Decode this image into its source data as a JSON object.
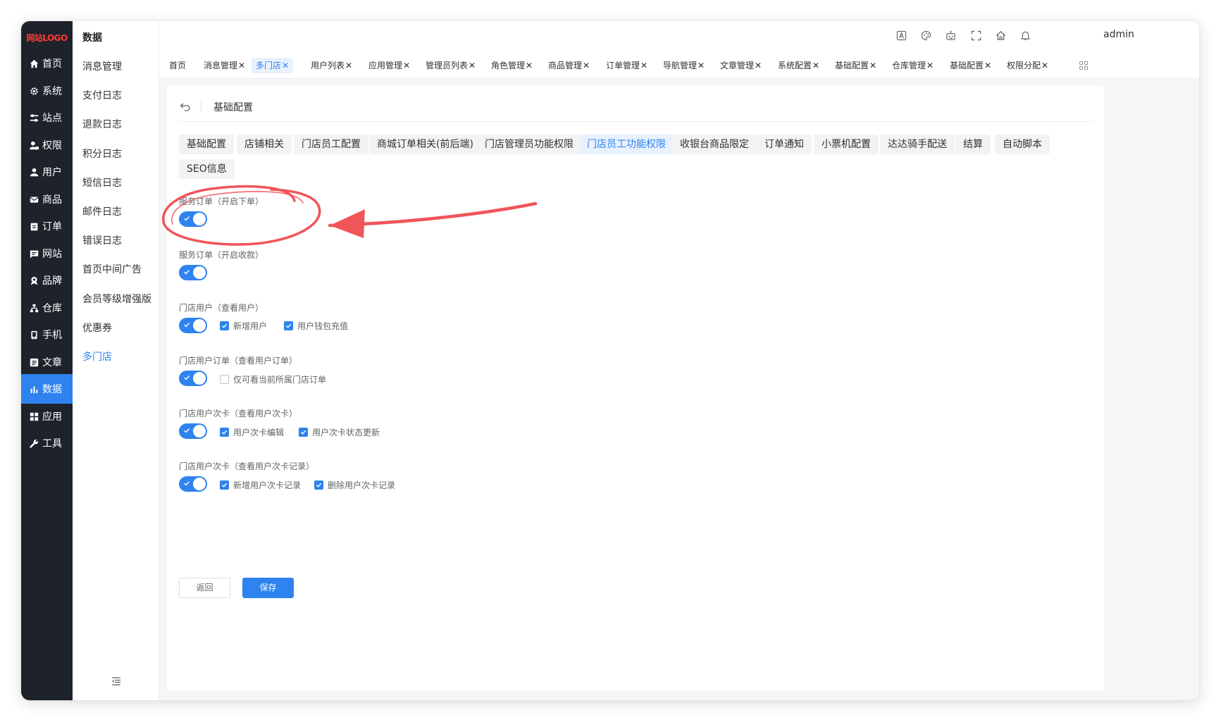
{
  "logo": "网站LOGO",
  "nav": {
    "items": [
      {
        "label": "首页",
        "icon": "home-icon"
      },
      {
        "label": "系统",
        "icon": "gear-icon"
      },
      {
        "label": "站点",
        "icon": "sliders-icon"
      },
      {
        "label": "权限",
        "icon": "user-lock-icon"
      },
      {
        "label": "用户",
        "icon": "user-icon"
      },
      {
        "label": "商品",
        "icon": "envelope-icon"
      },
      {
        "label": "订单",
        "icon": "clipboard-icon"
      },
      {
        "label": "网站",
        "icon": "message-icon"
      },
      {
        "label": "品牌",
        "icon": "award-icon"
      },
      {
        "label": "仓库",
        "icon": "sitemap-icon"
      },
      {
        "label": "手机",
        "icon": "phone-icon"
      },
      {
        "label": "文章",
        "icon": "article-icon"
      },
      {
        "label": "数据",
        "icon": "bar-chart-icon"
      },
      {
        "label": "应用",
        "icon": "grid-icon"
      },
      {
        "label": "工具",
        "icon": "wrench-icon"
      }
    ],
    "active": "数据"
  },
  "sub_menu": {
    "title": "数据",
    "items": [
      "消息管理",
      "支付日志",
      "退款日志",
      "积分日志",
      "短信日志",
      "邮件日志",
      "错误日志",
      "首页中间广告",
      "会员等级增强版",
      "优惠券",
      "多门店"
    ],
    "active": "多门店"
  },
  "header": {
    "icons": [
      "translate-icon",
      "palette-icon",
      "robot-icon",
      "fullscreen-icon",
      "home-icon",
      "bell-icon"
    ],
    "username": "admin"
  },
  "tabs": [
    {
      "label": "首页",
      "closable": false
    },
    {
      "label": "消息管理",
      "closable": true
    },
    {
      "label": "多门店",
      "closable": true
    },
    {
      "label": "用户列表",
      "closable": true
    },
    {
      "label": "应用管理",
      "closable": true
    },
    {
      "label": "管理员列表",
      "closable": true
    },
    {
      "label": "角色管理",
      "closable": true
    },
    {
      "label": "商品管理",
      "closable": true
    },
    {
      "label": "订单管理",
      "closable": true
    },
    {
      "label": "导航管理",
      "closable": true
    },
    {
      "label": "文章管理",
      "closable": true
    },
    {
      "label": "系统配置",
      "closable": true
    },
    {
      "label": "基础配置",
      "closable": true
    },
    {
      "label": "仓库管理",
      "closable": true
    },
    {
      "label": "基础配置",
      "closable": true
    },
    {
      "label": "权限分配",
      "closable": true
    }
  ],
  "active_tab": "多门店",
  "tab_close_glyph": "✕",
  "page": {
    "title": "基础配置",
    "config_tabs": [
      "基础配置",
      "店铺相关",
      "门店员工配置",
      "商城订单相关(前后端)",
      "门店管理员功能权限",
      "门店员工功能权限",
      "收银台商品限定",
      "订单通知",
      "小票机配置",
      "达达骑手配送",
      "结算",
      "自动脚本",
      "SEO信息"
    ],
    "active_config_tab": "门店员工功能权限",
    "permissions": [
      {
        "label": "服务订单（开启下单）",
        "enabled": true,
        "options": []
      },
      {
        "label": "服务订单（开启收款）",
        "enabled": true,
        "options": []
      },
      {
        "label": "门店用户（查看用户）",
        "enabled": true,
        "options": [
          {
            "label": "新增用户",
            "checked": true
          },
          {
            "label": "用户钱包充值",
            "checked": true
          }
        ]
      },
      {
        "label": "门店用户订单（查看用户订单）",
        "enabled": true,
        "options": [
          {
            "label": "仅可看当前所属门店订单",
            "checked": false
          }
        ]
      },
      {
        "label": "门店用户次卡（查看用户次卡）",
        "enabled": true,
        "options": [
          {
            "label": "用户次卡编辑",
            "checked": true
          },
          {
            "label": "用户次卡状态更新",
            "checked": true
          }
        ]
      },
      {
        "label": "门店用户次卡（查看用户次卡记录）",
        "enabled": true,
        "options": [
          {
            "label": "新增用户次卡记录",
            "checked": true
          },
          {
            "label": "删除用户次卡记录",
            "checked": true
          }
        ]
      }
    ],
    "buttons": {
      "back": "返回",
      "save": "保存"
    }
  },
  "colors": {
    "primary": "#2e83ee",
    "sidebar": "#1e222b",
    "annotation": "#f0555a"
  }
}
